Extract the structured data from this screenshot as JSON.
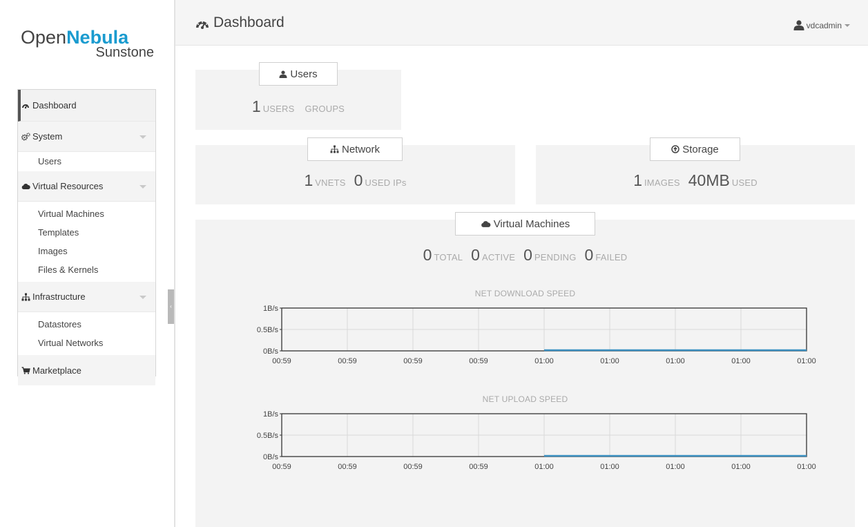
{
  "app": {
    "logo_open": "Open",
    "logo_nebula": "Nebula",
    "logo_sub": "Sunstone"
  },
  "header": {
    "title": "Dashboard",
    "user": "vdcadmin"
  },
  "sidebar": {
    "dashboard": "Dashboard",
    "system": {
      "label": "System",
      "items": [
        "Users"
      ]
    },
    "virtual_resources": {
      "label": "Virtual Resources",
      "items": [
        "Virtual Machines",
        "Templates",
        "Images",
        "Files & Kernels"
      ]
    },
    "infrastructure": {
      "label": "Infrastructure",
      "items": [
        "Datastores",
        "Virtual Networks"
      ]
    },
    "marketplace": "Marketplace"
  },
  "users_panel": {
    "title": "Users",
    "count": "1",
    "users_label": "USERS",
    "groups_label": "GROUPS"
  },
  "network_panel": {
    "title": "Network",
    "vnets": "1",
    "vnets_label": "VNETS",
    "used_ips": "0",
    "used_ips_label": "USED IPs"
  },
  "storage_panel": {
    "title": "Storage",
    "images": "1",
    "images_label": "IMAGES",
    "used_size": "40MB",
    "used_label": "USED"
  },
  "vm_panel": {
    "title": "Virtual Machines",
    "total": "0",
    "total_label": "TOTAL",
    "active": "0",
    "active_label": "ACTIVE",
    "pending": "0",
    "pending_label": "PENDING",
    "failed": "0",
    "failed_label": "FAILED"
  },
  "colors": {
    "accent": "#1a9bcf",
    "series": "#3a8fc0"
  },
  "chart_data": [
    {
      "type": "line",
      "title": "NET DOWNLOAD SPEED",
      "x": [
        "00:59",
        "00:59",
        "00:59",
        "00:59",
        "01:00",
        "01:00",
        "01:00",
        "01:00",
        "01:00"
      ],
      "y_ticks": [
        "1B/s",
        "0.5B/s",
        "0B/s"
      ],
      "ylim": [
        0,
        1
      ],
      "grid": true,
      "series": [
        {
          "values": [
            null,
            null,
            null,
            null,
            0,
            0,
            0,
            0,
            0
          ]
        }
      ]
    },
    {
      "type": "line",
      "title": "NET UPLOAD SPEED",
      "x": [
        "00:59",
        "00:59",
        "00:59",
        "00:59",
        "01:00",
        "01:00",
        "01:00",
        "01:00",
        "01:00"
      ],
      "y_ticks": [
        "1B/s",
        "0.5B/s",
        "0B/s"
      ],
      "ylim": [
        0,
        1
      ],
      "grid": true,
      "series": [
        {
          "values": [
            null,
            null,
            null,
            null,
            0,
            0,
            0,
            0,
            0
          ]
        }
      ]
    }
  ]
}
